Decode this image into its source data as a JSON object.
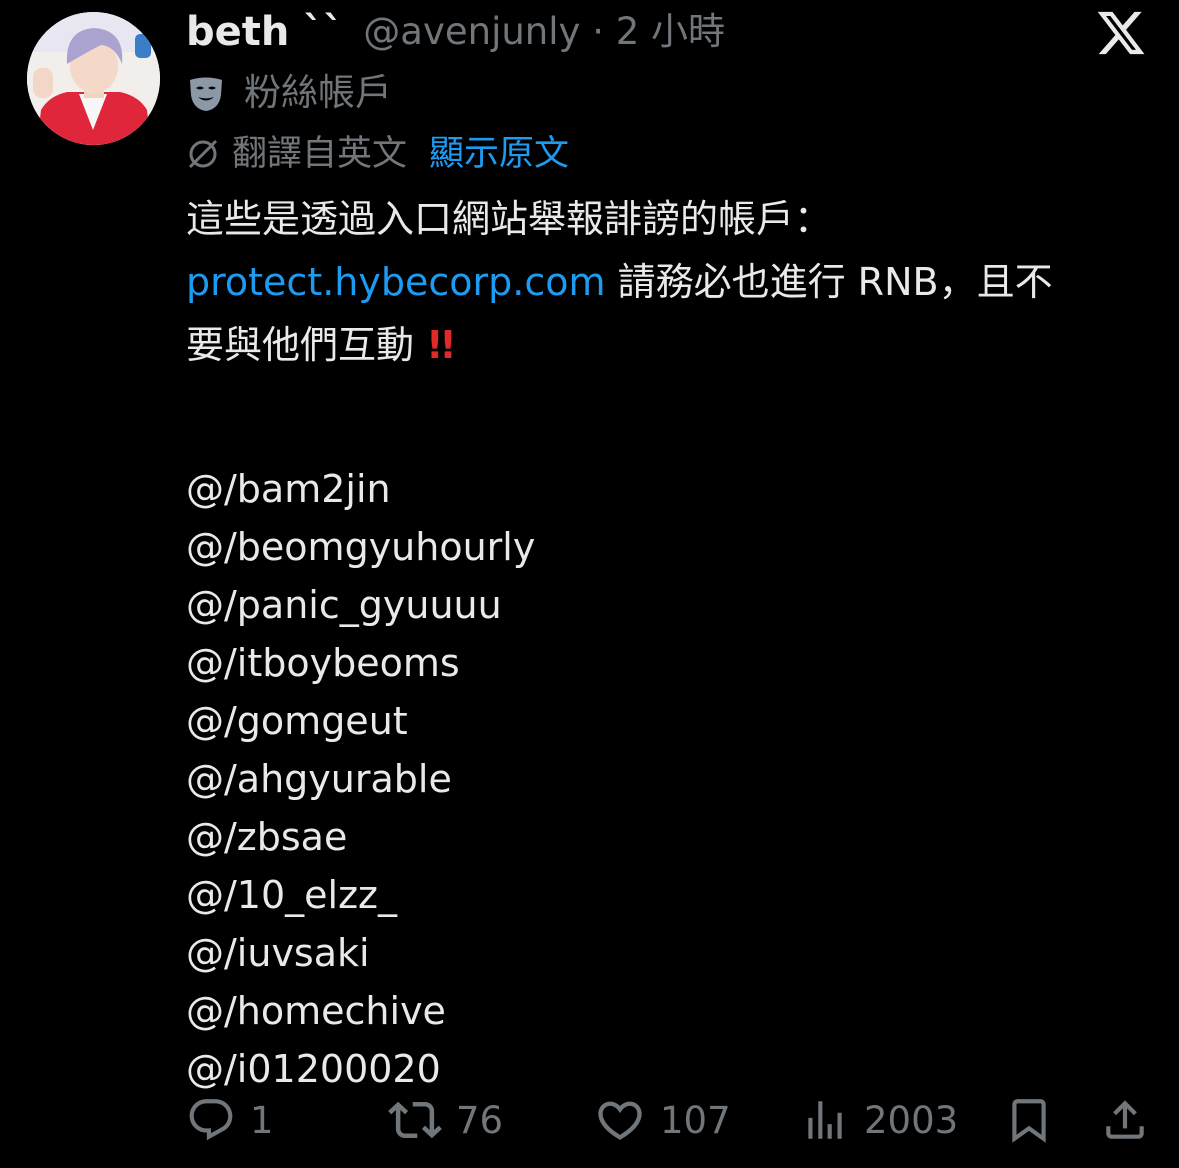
{
  "tweet": {
    "author": {
      "display_name": "beth ``",
      "handle_meta": "@avenjunly · 2 小時",
      "label": "粉絲帳戶",
      "label_icon": "mask-icon"
    },
    "platform_icon": "x-logo",
    "translation": {
      "translated_from": "翻譯自英文",
      "show_original": "顯示原文"
    },
    "body": {
      "line1": "這些是透過入口網站舉報誹謗的帳戶：",
      "link": "protect.hybecorp.com",
      "line2_rest": " 請務必也進行 RNB，且不",
      "line3": "要與他們互動 ",
      "emphasis": "!!",
      "mentions": [
        "@/bam2jin",
        "@/beomgyuhourly",
        "@/panic_gyuuuu",
        "@/itboybeoms",
        "@/gomgeut",
        "@/ahgyurable",
        "@/zbsae",
        "@/10_elzz_",
        "@/iuvsaki",
        "@/homechive",
        "@/i01200020"
      ]
    },
    "actions": {
      "replies": "1",
      "reposts": "76",
      "likes": "107",
      "views": "2003"
    }
  },
  "colors": {
    "background": "#000000",
    "primary_text": "#e7e9ea",
    "secondary_text": "#71767b",
    "link": "#1d9bf0",
    "emphasis": "#e02a2a"
  }
}
